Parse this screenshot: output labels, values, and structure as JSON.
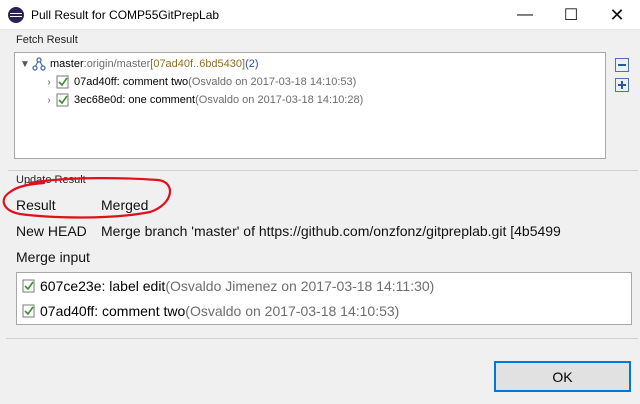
{
  "window": {
    "title": "Pull Result for COMP55GitPrepLab",
    "minimize": "—",
    "maximize": "☐",
    "close": "✕"
  },
  "fetch": {
    "label": "Fetch Result",
    "ref": {
      "name": "master",
      "sep": " : ",
      "remote": "origin/master",
      "range": " [07ad40f..6bd5430]",
      "count": " (2)"
    },
    "commits": [
      {
        "id_msg": "07ad40ff: comment two",
        "meta": " (Osvaldo on 2017-03-18 14:10:53)"
      },
      {
        "id_msg": "3ec68e0d: one comment",
        "meta": " (Osvaldo on 2017-03-18 14:10:28)"
      }
    ]
  },
  "update": {
    "label": "Update Result",
    "result_key": "Result",
    "result_value": "Merged",
    "new_head_key": "New HEAD",
    "new_head_value": "Merge branch 'master' of https://github.com/onzfonz/gitpreplab.git [4b5499",
    "merge_input_label": "Merge input",
    "merge_inputs": [
      {
        "id_msg": "607ce23e: label edit",
        "meta": " (Osvaldo Jimenez on 2017-03-18 14:11:30)"
      },
      {
        "id_msg": "07ad40ff: comment two",
        "meta": " (Osvaldo on 2017-03-18 14:10:53)"
      }
    ]
  },
  "buttons": {
    "ok": "OK"
  },
  "icons": {
    "app": "eclipse-icon",
    "ref": "branch-icon",
    "commit": "commit-icon",
    "collapse": "collapse-all-icon",
    "expand": "expand-all-icon"
  },
  "colors": {
    "annotation": "#e0101a",
    "focus_border": "#0078d7",
    "link_blue": "#2b4fb0",
    "range_gold": "#8b6f24"
  }
}
